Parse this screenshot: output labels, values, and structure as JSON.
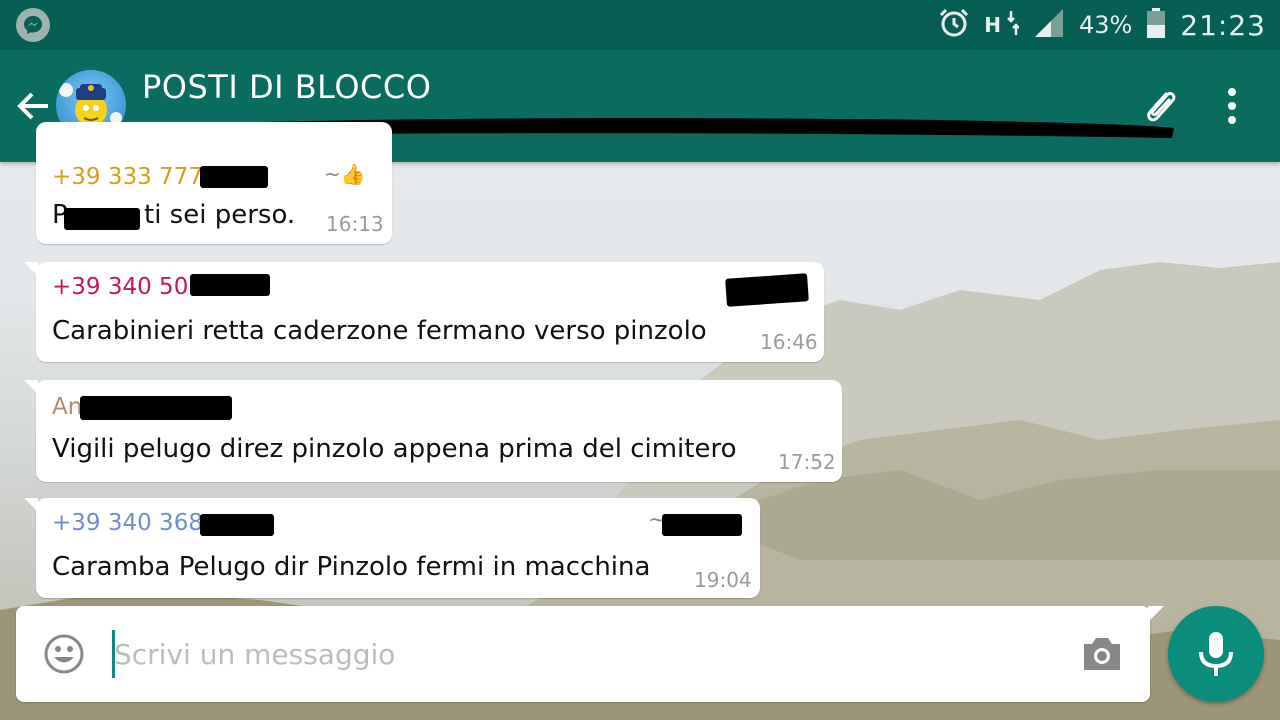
{
  "status_bar": {
    "network": "H",
    "battery": "43%",
    "clock": "21:23",
    "icons": [
      "messenger-icon",
      "alarm-icon",
      "network-icon",
      "signal-icon",
      "battery-icon"
    ]
  },
  "header": {
    "title": "POSTI DI BLOCCO",
    "icons": [
      "back-arrow-icon",
      "paperclip-icon",
      "more-vert-icon"
    ]
  },
  "messages": [
    {
      "sender": "+39 333 777",
      "sender_color": "#d4a01a",
      "text": "ti sei perso.",
      "text_prefix": "P",
      "time": "16:13",
      "extra": "~👍"
    },
    {
      "sender": "+39 340 508",
      "sender_color": "#c2185b",
      "text": "Carabinieri retta caderzone fermano verso pinzolo",
      "time": "16:46"
    },
    {
      "sender": "An",
      "sender_color": "#b08a73",
      "text": "Vigili pelugo direz pinzolo appena prima del cimitero",
      "time": "17:52"
    },
    {
      "sender": "+39 340 368",
      "sender_color": "#6e8fc9",
      "text": "Caramba Pelugo dir Pinzolo fermi in macchina",
      "time": "19:04",
      "extra": "~"
    }
  ],
  "composer": {
    "placeholder": "Scrivi un messaggio",
    "icons": [
      "emoji-icon",
      "camera-icon",
      "mic-icon"
    ]
  },
  "colors": {
    "status_bar": "#075e54",
    "app_bar": "#0a6b5f",
    "mic_button": "#0b8d7e"
  }
}
